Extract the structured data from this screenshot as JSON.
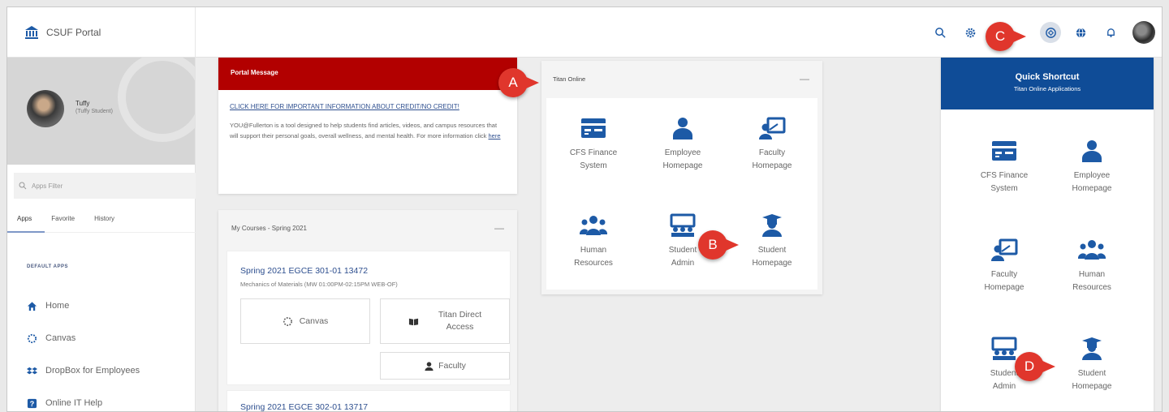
{
  "brand": {
    "name": "CSUF Portal"
  },
  "header_icons": [
    "search-icon",
    "settings-icon",
    "message-icon",
    "shortcut-icon",
    "globe-icon",
    "bell-icon"
  ],
  "profile": {
    "name": "Tuffy",
    "role": "(Tuffy Student)"
  },
  "sidebar": {
    "filter_placeholder": "Apps Filter",
    "tabs": [
      "Apps",
      "Favorite",
      "History"
    ],
    "section_title": "DEFAULT APPS",
    "items": [
      {
        "label": "Home",
        "icon": "home-icon"
      },
      {
        "label": "Canvas",
        "icon": "canvas-icon"
      },
      {
        "label": "DropBox for Employees",
        "icon": "dropbox-icon"
      },
      {
        "label": "Online IT Help",
        "icon": "help-icon"
      }
    ]
  },
  "portal_message": {
    "title": "Portal Message",
    "link": "CLICK HERE FOR IMPORTANT INFORMATION ABOUT CREDIT/NO CREDIT!",
    "body": "YOU@Fullerton is a tool designed to help students find articles, videos, and campus resources that will support their personal goals, overall wellness, and mental health. For more information click",
    "body_link": "here"
  },
  "courses": {
    "title": "My Courses - Spring 2021",
    "course1": {
      "title": "Spring 2021 EGCE 301-01 13472",
      "subtitle": "Mechanics of Materials (MW 01:00PM-02:15PM WEB-OF)",
      "canvas": "Canvas",
      "titan_line1": "Titan Direct",
      "titan_line2": "Access",
      "faculty": "Faculty"
    },
    "course2": {
      "title": "Spring 2021 EGCE 302-01 13717"
    }
  },
  "titan_online": {
    "title": "Titan Online",
    "apps": [
      {
        "line1": "CFS Finance",
        "line2": "System",
        "icon": "finance-icon"
      },
      {
        "line1": "Employee",
        "line2": "Homepage",
        "icon": "person-icon"
      },
      {
        "line1": "Faculty",
        "line2": "Homepage",
        "icon": "faculty-icon"
      },
      {
        "line1": "Human",
        "line2": "Resources",
        "icon": "group-icon"
      },
      {
        "line1": "Student",
        "line2": "Admin",
        "icon": "student-admin-icon"
      },
      {
        "line1": "Student",
        "line2": "Homepage",
        "icon": "graduate-icon"
      }
    ]
  },
  "quick_shortcut": {
    "title": "Quick Shortcut",
    "subtitle": "Titan Online Applications",
    "apps": [
      {
        "line1": "CFS Finance",
        "line2": "System"
      },
      {
        "line1": "Employee",
        "line2": "Homepage"
      },
      {
        "line1": "Faculty",
        "line2": "Homepage"
      },
      {
        "line1": "Human",
        "line2": "Resources"
      },
      {
        "line1": "Student",
        "line2": "Admin"
      },
      {
        "line1": "Student",
        "line2": "Homepage"
      }
    ]
  },
  "callouts": {
    "a": "A",
    "b": "B",
    "c": "C",
    "d": "D"
  },
  "colors": {
    "brand_blue": "#0f4c97",
    "portal_red": "#b20000",
    "callout_red": "#e0362c",
    "link_blue": "#2e4f8f"
  }
}
